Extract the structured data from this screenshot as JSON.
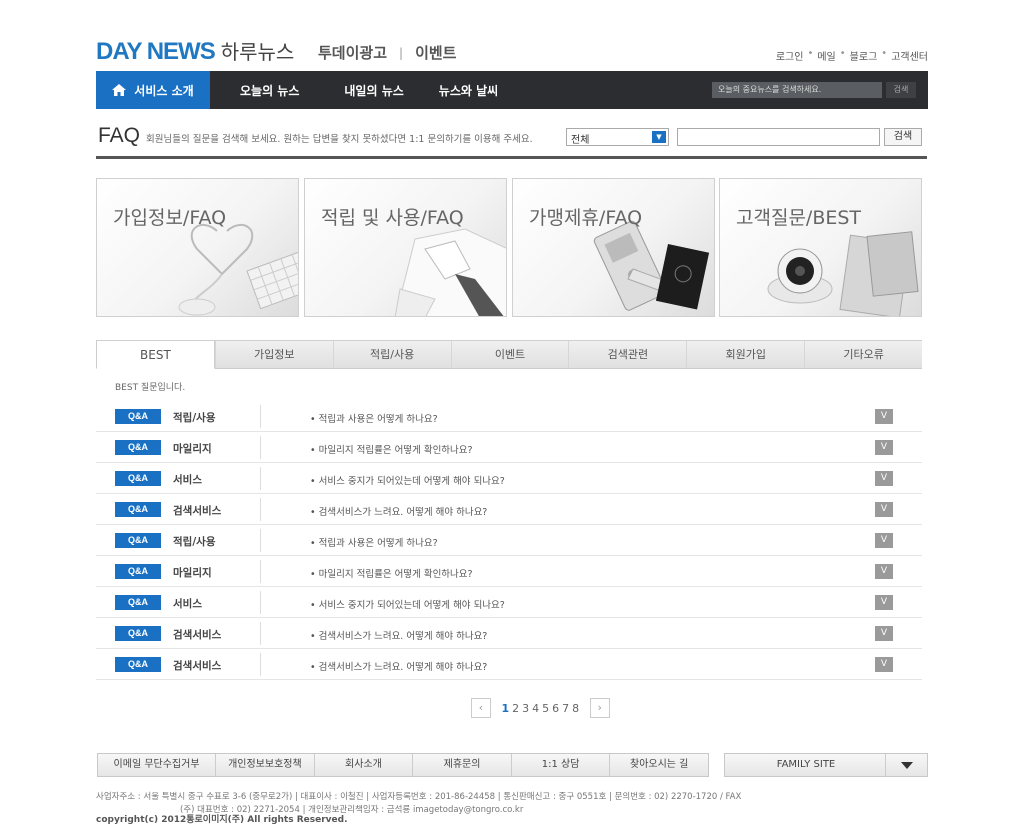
{
  "header": {
    "logo_main": "DAY NEWS",
    "logo_sub": "하루뉴스",
    "top_links": [
      "투데이광고",
      "이벤트"
    ],
    "utility_links": [
      "로그인",
      "메일",
      "블로그",
      "고객센터"
    ]
  },
  "nav": {
    "home_label": "서비스 소개",
    "items": [
      "오늘의 뉴스",
      "내일의 뉴스",
      "뉴스와 날씨"
    ],
    "search_placeholder": "오늘의 중요뉴스를 검색하세요.",
    "search_button": "검색"
  },
  "faq": {
    "title": "FAQ",
    "description": "회원님들의 질문을 검색해 보세요. 원하는 답변을 찾지 못하셨다면 1:1 문의하기를 이용해 주세요.",
    "select_value": "전체",
    "search_button": "검색"
  },
  "cards": [
    {
      "label": "가입정보/FAQ"
    },
    {
      "label": "적립 및 사용/FAQ"
    },
    {
      "label": "가맹제휴/FAQ"
    },
    {
      "label": "고객질문/BEST"
    }
  ],
  "tabs": [
    "BEST",
    "가입정보",
    "적립/사용",
    "이벤트",
    "검색관련",
    "회원가입",
    "기타오류"
  ],
  "best_note": "BEST 질문입니다.",
  "qa_badge": "Q&A",
  "qa_toggle": "V",
  "qa_items": [
    {
      "category": "적립/사용",
      "question": "• 적립과 사용은 어떻게 하나요?"
    },
    {
      "category": "마일리지",
      "question": "• 마일리지 적립률은 어떻게 확인하나요?"
    },
    {
      "category": "서비스",
      "question": "• 서비스 중지가 되어있는데 어떻게 해야 되나요?"
    },
    {
      "category": "검색서비스",
      "question": "• 검색서비스가 느려요. 어떻게 해야 하나요?"
    },
    {
      "category": "적립/사용",
      "question": "• 적립과 사용은 어떻게 하나요?"
    },
    {
      "category": "마일리지",
      "question": "• 마일리지 적립률은 어떻게 확인하나요?"
    },
    {
      "category": "서비스",
      "question": "• 서비스 중지가 되어있는데 어떻게 해야 되나요?"
    },
    {
      "category": "검색서비스",
      "question": "• 검색서비스가 느려요. 어떻게 해야 하나요?"
    },
    {
      "category": "검색서비스",
      "question": "• 검색서비스가 느려요. 어떻게 해야 하나요?"
    }
  ],
  "pagination": {
    "prev": "‹",
    "next": "›",
    "pages": [
      "1",
      "2",
      "3",
      "4",
      "5",
      "6",
      "7",
      "8"
    ],
    "current": "1"
  },
  "footer": {
    "links": [
      "이메일 무단수집거부",
      "개인정보보호정책",
      "회사소개",
      "제휴문의",
      "1:1 상담",
      "찾아오시는 길"
    ],
    "family_site": "FAMILY SITE",
    "address": "사업자주소 : 서울 특별시 중구 수표로 3-6 (중무로2가) | 대표이사 : 이철진 | 사업자등록번호 : 201-86-24458 | 통신판매신고 : 중구 0551호 | 문의번호 : 02) 2270-1720 / FAX",
    "address2": "(주) 대표번호 : 02) 2271-2054 | 개인정보관리책임자 : 금석룡 imagetoday@tongro.co.kr",
    "copyright": "copyright(c) 2012통로이미지(주) All rights Reserved."
  },
  "colors": {
    "brand_blue": "#1a71c4",
    "nav_dark": "#2b2d30",
    "toggle_gray": "#9a9a9a"
  }
}
